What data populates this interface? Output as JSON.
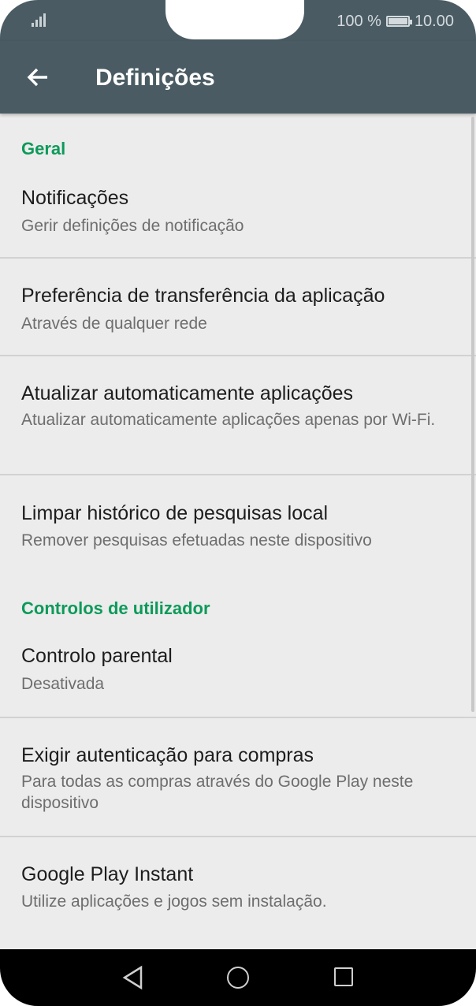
{
  "status_bar": {
    "battery_text": "100 %",
    "time": "10.00"
  },
  "app_bar": {
    "title": "Definições",
    "back_icon": "arrow-left-icon"
  },
  "sections": [
    {
      "header": "Geral",
      "items": [
        {
          "title": "Notificações",
          "subtitle": "Gerir definições de notificação"
        },
        {
          "title": "Preferência de transferência da aplicação",
          "subtitle": "Através de qualquer rede"
        },
        {
          "title": "Atualizar automaticamente aplicações",
          "subtitle": "Atualizar automaticamente aplicações apenas por Wi-Fi."
        },
        {
          "title": "Limpar histórico de pesquisas local",
          "subtitle": "Remover pesquisas efetuadas neste dispositivo"
        }
      ]
    },
    {
      "header": "Controlos de utilizador",
      "items": [
        {
          "title": "Controlo parental",
          "subtitle": "Desativada"
        },
        {
          "title": "Exigir autenticação para compras",
          "subtitle": "Para todas as compras através do Google Play neste dispositivo"
        },
        {
          "title": "Google Play Instant",
          "subtitle": "Utilize aplicações e jogos sem instalação."
        }
      ]
    }
  ],
  "nav_bar": {
    "back_icon": "triangle-back-icon",
    "home_icon": "circle-home-icon",
    "recents_icon": "square-recents-icon"
  },
  "colors": {
    "app_bar": "#4a5b63",
    "accent": "#0d9a5a",
    "background": "#ececec"
  }
}
